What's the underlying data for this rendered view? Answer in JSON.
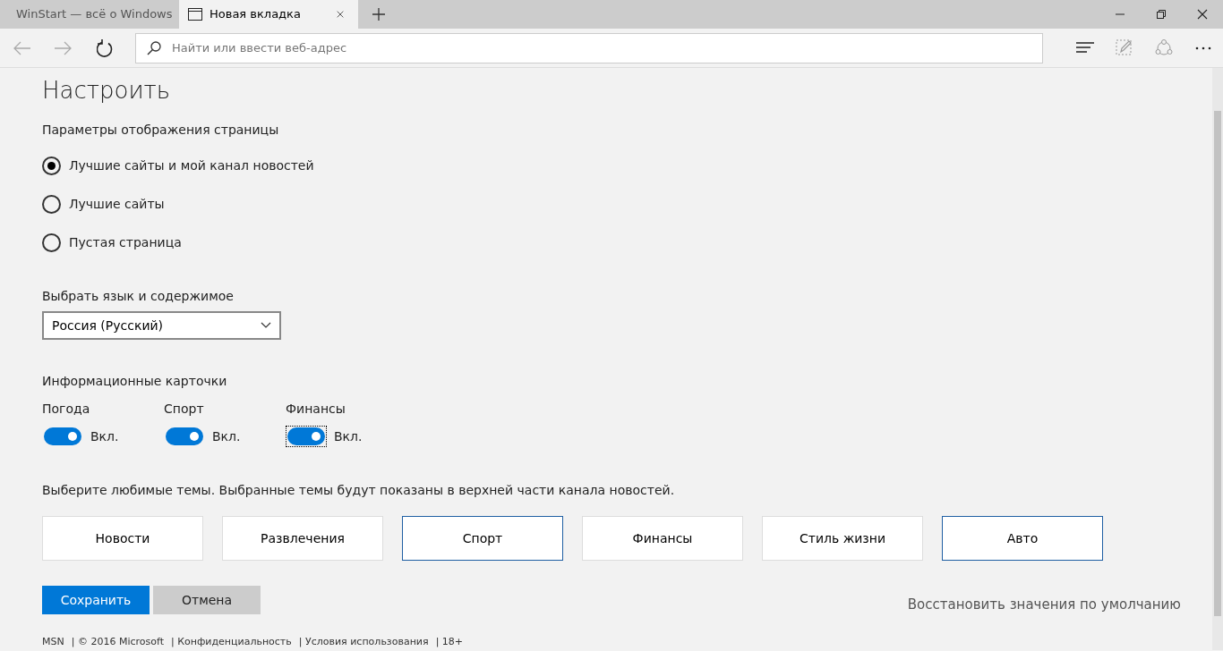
{
  "tabs": [
    {
      "title": "WinStart — всё о Windows",
      "selected": false,
      "kind": "site"
    },
    {
      "title": "Новая вкладка",
      "selected": true,
      "kind": "page"
    }
  ],
  "address_bar": {
    "placeholder": "Найти или ввести веб-адрес"
  },
  "heading": "Настроить",
  "display_options": {
    "label": "Параметры отображения страницы",
    "options": [
      {
        "label": "Лучшие сайты и мой канал новостей",
        "selected": true
      },
      {
        "label": "Лучшие сайты",
        "selected": false
      },
      {
        "label": "Пустая страница",
        "selected": false
      }
    ]
  },
  "language": {
    "label": "Выбрать язык и содержимое",
    "value": "Россия (Русский)"
  },
  "cards": {
    "label": "Информационные карточки",
    "toggles": [
      {
        "label": "Погода",
        "on": true,
        "state_text": "Вкл.",
        "focused": false
      },
      {
        "label": "Спорт",
        "on": true,
        "state_text": "Вкл.",
        "focused": false
      },
      {
        "label": "Финансы",
        "on": true,
        "state_text": "Вкл.",
        "focused": true
      }
    ]
  },
  "topics": {
    "label": "Выберите любимые темы. Выбранные темы будут показаны в верхней части канала новостей.",
    "items": [
      {
        "label": "Новости",
        "selected": false
      },
      {
        "label": "Развлечения",
        "selected": false
      },
      {
        "label": "Спорт",
        "selected": true
      },
      {
        "label": "Финансы",
        "selected": false
      },
      {
        "label": "Стиль жизни",
        "selected": false
      },
      {
        "label": "Авто",
        "selected": true
      }
    ]
  },
  "buttons": {
    "save": "Сохранить",
    "cancel": "Отмена",
    "reset": "Восстановить значения по умолчанию"
  },
  "footer": [
    "MSN",
    "| © 2016 Microsoft",
    "| Конфиденциальность",
    "| Условия использования",
    "| 18+"
  ]
}
